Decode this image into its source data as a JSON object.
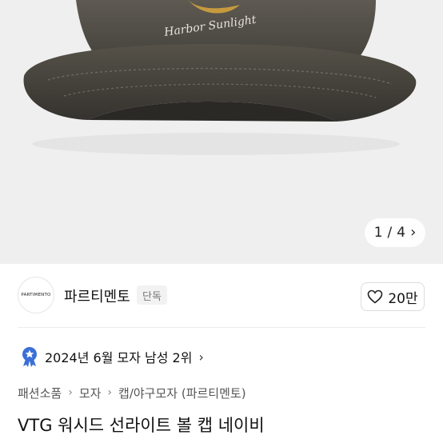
{
  "gallery": {
    "image_label": "Harbor Sunlight",
    "counter": {
      "current": "1",
      "separator": "/",
      "total": "4"
    },
    "next_icon": "chevron-right-icon"
  },
  "brand": {
    "logo_text": "PARTIMENTO",
    "name": "파르티멘토",
    "tag": "단독",
    "like_icon": "heart-outline-icon",
    "like_count": "20만"
  },
  "ranking": {
    "badge_icon": "ranking-medal-icon",
    "badge_color": "#3b6fd8",
    "text": "2024년 6월 모자 남성 2위",
    "chevron_icon": "chevron-right-icon"
  },
  "breadcrumb": [
    "패션소품",
    "모자",
    "캡/야구모자 (파르티멘토)"
  ],
  "product": {
    "title": "VTG 워시드 선라이트 볼 캡 네이비"
  }
}
